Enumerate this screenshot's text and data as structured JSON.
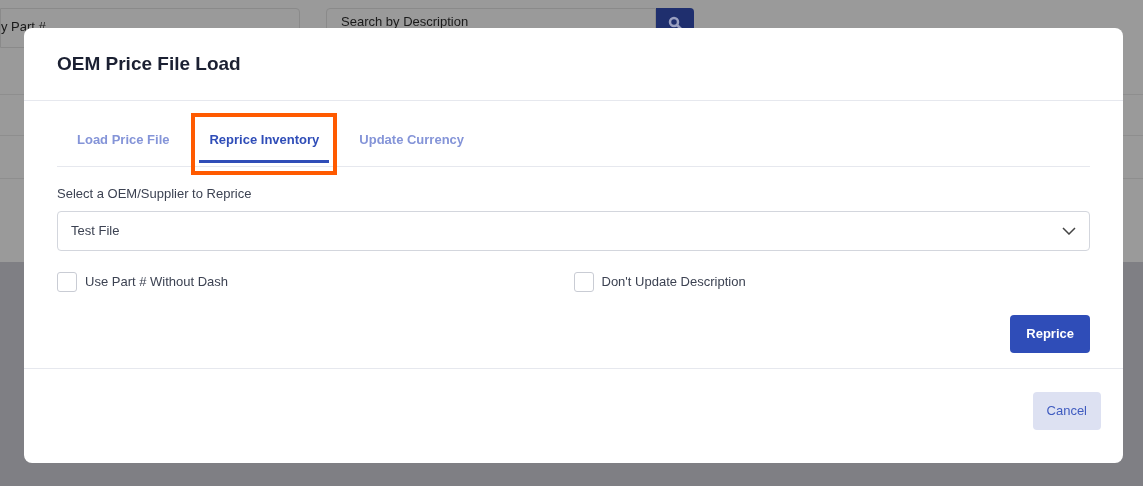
{
  "background": {
    "part_search": {
      "value": "y Part #"
    },
    "description_search": {
      "placeholder": "Search by Description"
    }
  },
  "dialog": {
    "title": "OEM Price File Load",
    "tabs": [
      {
        "label": "Load Price File",
        "selected": false,
        "highlighted": false
      },
      {
        "label": "Reprice Inventory",
        "selected": true,
        "highlighted": true
      },
      {
        "label": "Update Currency",
        "selected": false,
        "highlighted": false
      }
    ],
    "select_label": "Select a OEM/Supplier to Reprice",
    "select_value": "Test File",
    "options": [
      {
        "label": "Use Part # Without Dash",
        "checked": false
      },
      {
        "label": "Don't Update Description",
        "checked": false
      }
    ],
    "action_button": "Reprice",
    "footer_button": "Cancel"
  }
}
